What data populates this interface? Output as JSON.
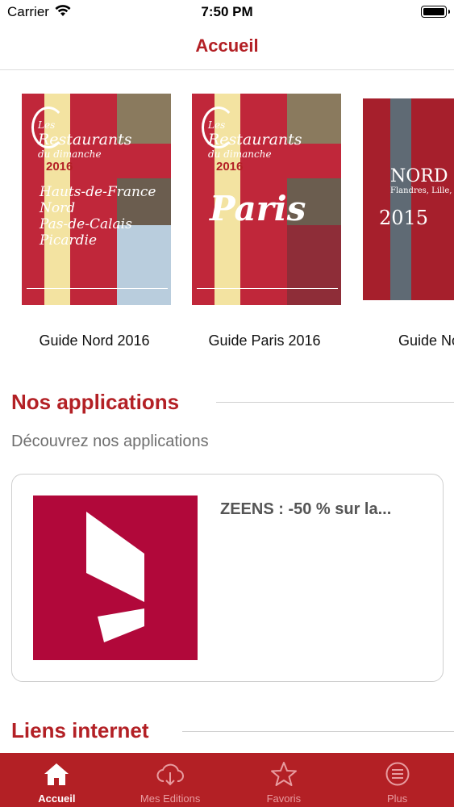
{
  "status_bar": {
    "carrier": "Carrier",
    "time": "7:50 PM"
  },
  "nav": {
    "title": "Accueil"
  },
  "guides": [
    {
      "label": "Guide Nord 2016",
      "cover": {
        "logo_top": "Les",
        "logo_main": "Restaurants",
        "logo_sub": "du dimanche",
        "year": "2016",
        "region_lines": [
          "Hauts-de-France",
          "Nord",
          "Pas-de-Calais",
          "Picardie"
        ]
      }
    },
    {
      "label": "Guide Paris 2016",
      "cover": {
        "logo_top": "Les",
        "logo_main": "Restaurants",
        "logo_sub": "du dimanche",
        "year": "2016",
        "city": "Paris"
      }
    },
    {
      "label": "Guide Nord",
      "cover": {
        "title": "NORD",
        "subtitle": "Flandres, Lille, Hainaut",
        "year": "2015"
      }
    }
  ],
  "apps_section": {
    "title": "Nos applications",
    "subtitle": "Découvrez nos applications"
  },
  "app": {
    "name": "ZEENS : -50 % sur la..."
  },
  "links_section": {
    "title": "Liens internet"
  },
  "tabs": [
    {
      "label": "Accueil",
      "icon": "home-icon",
      "active": true
    },
    {
      "label": "Mes Editions",
      "icon": "cloud-download-icon",
      "active": false
    },
    {
      "label": "Favoris",
      "icon": "star-icon",
      "active": false
    },
    {
      "label": "Plus",
      "icon": "menu-icon",
      "active": false
    }
  ],
  "colors": {
    "accent": "#b32025",
    "app_icon_bg": "#b1083a",
    "tab_inactive": "#e89ca0"
  }
}
